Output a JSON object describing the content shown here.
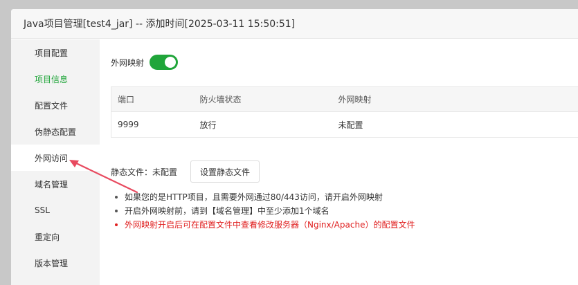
{
  "dialog": {
    "title": "Java项目管理[test4_jar] -- 添加时间[2025-03-11 15:50:51]"
  },
  "sidebar": {
    "items": [
      {
        "label": "项目配置"
      },
      {
        "label": "项目信息"
      },
      {
        "label": "配置文件"
      },
      {
        "label": "伪静态配置"
      },
      {
        "label": "外网访问"
      },
      {
        "label": "域名管理"
      },
      {
        "label": "SSL"
      },
      {
        "label": "重定向"
      },
      {
        "label": "版本管理"
      }
    ]
  },
  "content": {
    "toggle_label": "外网映射",
    "toggle_state": "on",
    "table": {
      "headers": [
        "端口",
        "防火墙状态",
        "外网映射"
      ],
      "rows": [
        [
          "9999",
          "放行",
          "未配置"
        ]
      ]
    },
    "static_label": "静态文件：未配置",
    "static_button": "设置静态文件",
    "tips": [
      "如果您的是HTTP项目，且需要外网通过80/443访问，请开启外网映射",
      "开启外网映射前，请到【域名管理】中至少添加1个域名",
      "外网映射开启后可在配置文件中查看修改服务器（Nginx/Apache）的配置文件"
    ]
  },
  "colors": {
    "accent_green": "#20a53a",
    "warning_red": "#e02020",
    "arrow_red": "#e84a5f"
  }
}
